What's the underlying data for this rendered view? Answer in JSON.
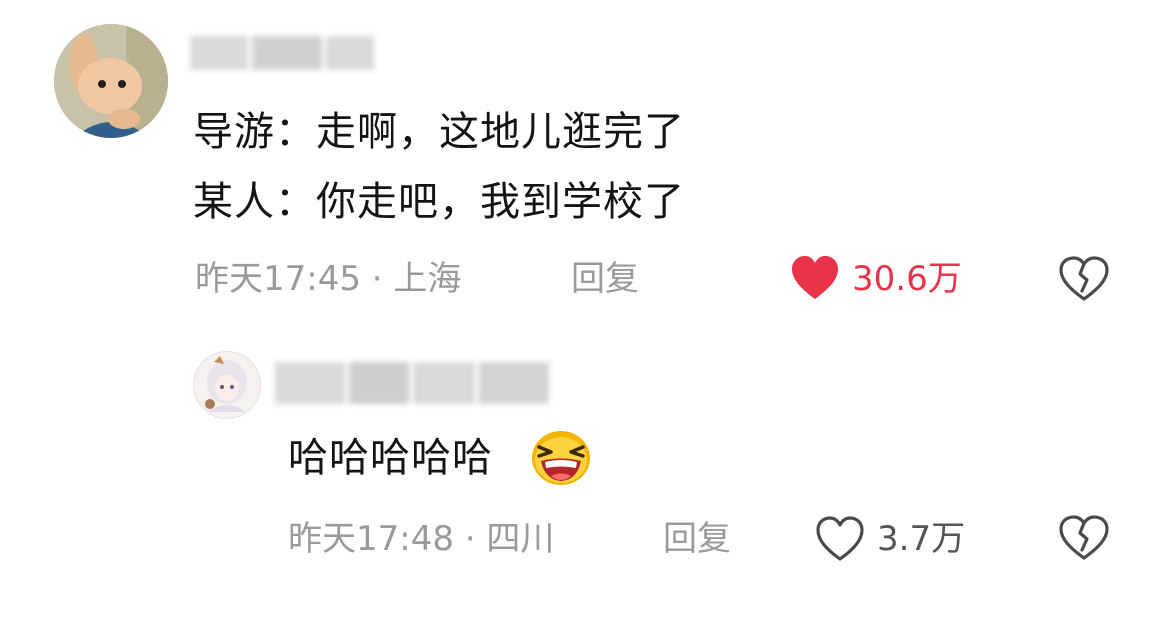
{
  "comment": {
    "username": "",
    "lines": [
      "导游：走啊，这地儿逛完了",
      "某人：你走吧，我到学校了"
    ],
    "time_location": "昨天17:45 · 上海",
    "reply_label": "回复",
    "like_count": "30.6万",
    "liked": true,
    "avatar_icon": "cartoon-rabbit-avatar-icon",
    "like_icon": "heart-filled-icon",
    "dislike_icon": "broken-heart-icon",
    "accent_color": "#e8334a"
  },
  "reply": {
    "username": "",
    "text": "哈哈哈哈哈",
    "emoji_icon": "laughing-emoji-icon",
    "time_location": "昨天17:48 · 四川",
    "reply_label": "回复",
    "like_count": "3.7万",
    "liked": false,
    "avatar_icon": "anime-girl-avatar-icon",
    "like_icon": "heart-outline-icon",
    "dislike_icon": "broken-heart-icon"
  }
}
